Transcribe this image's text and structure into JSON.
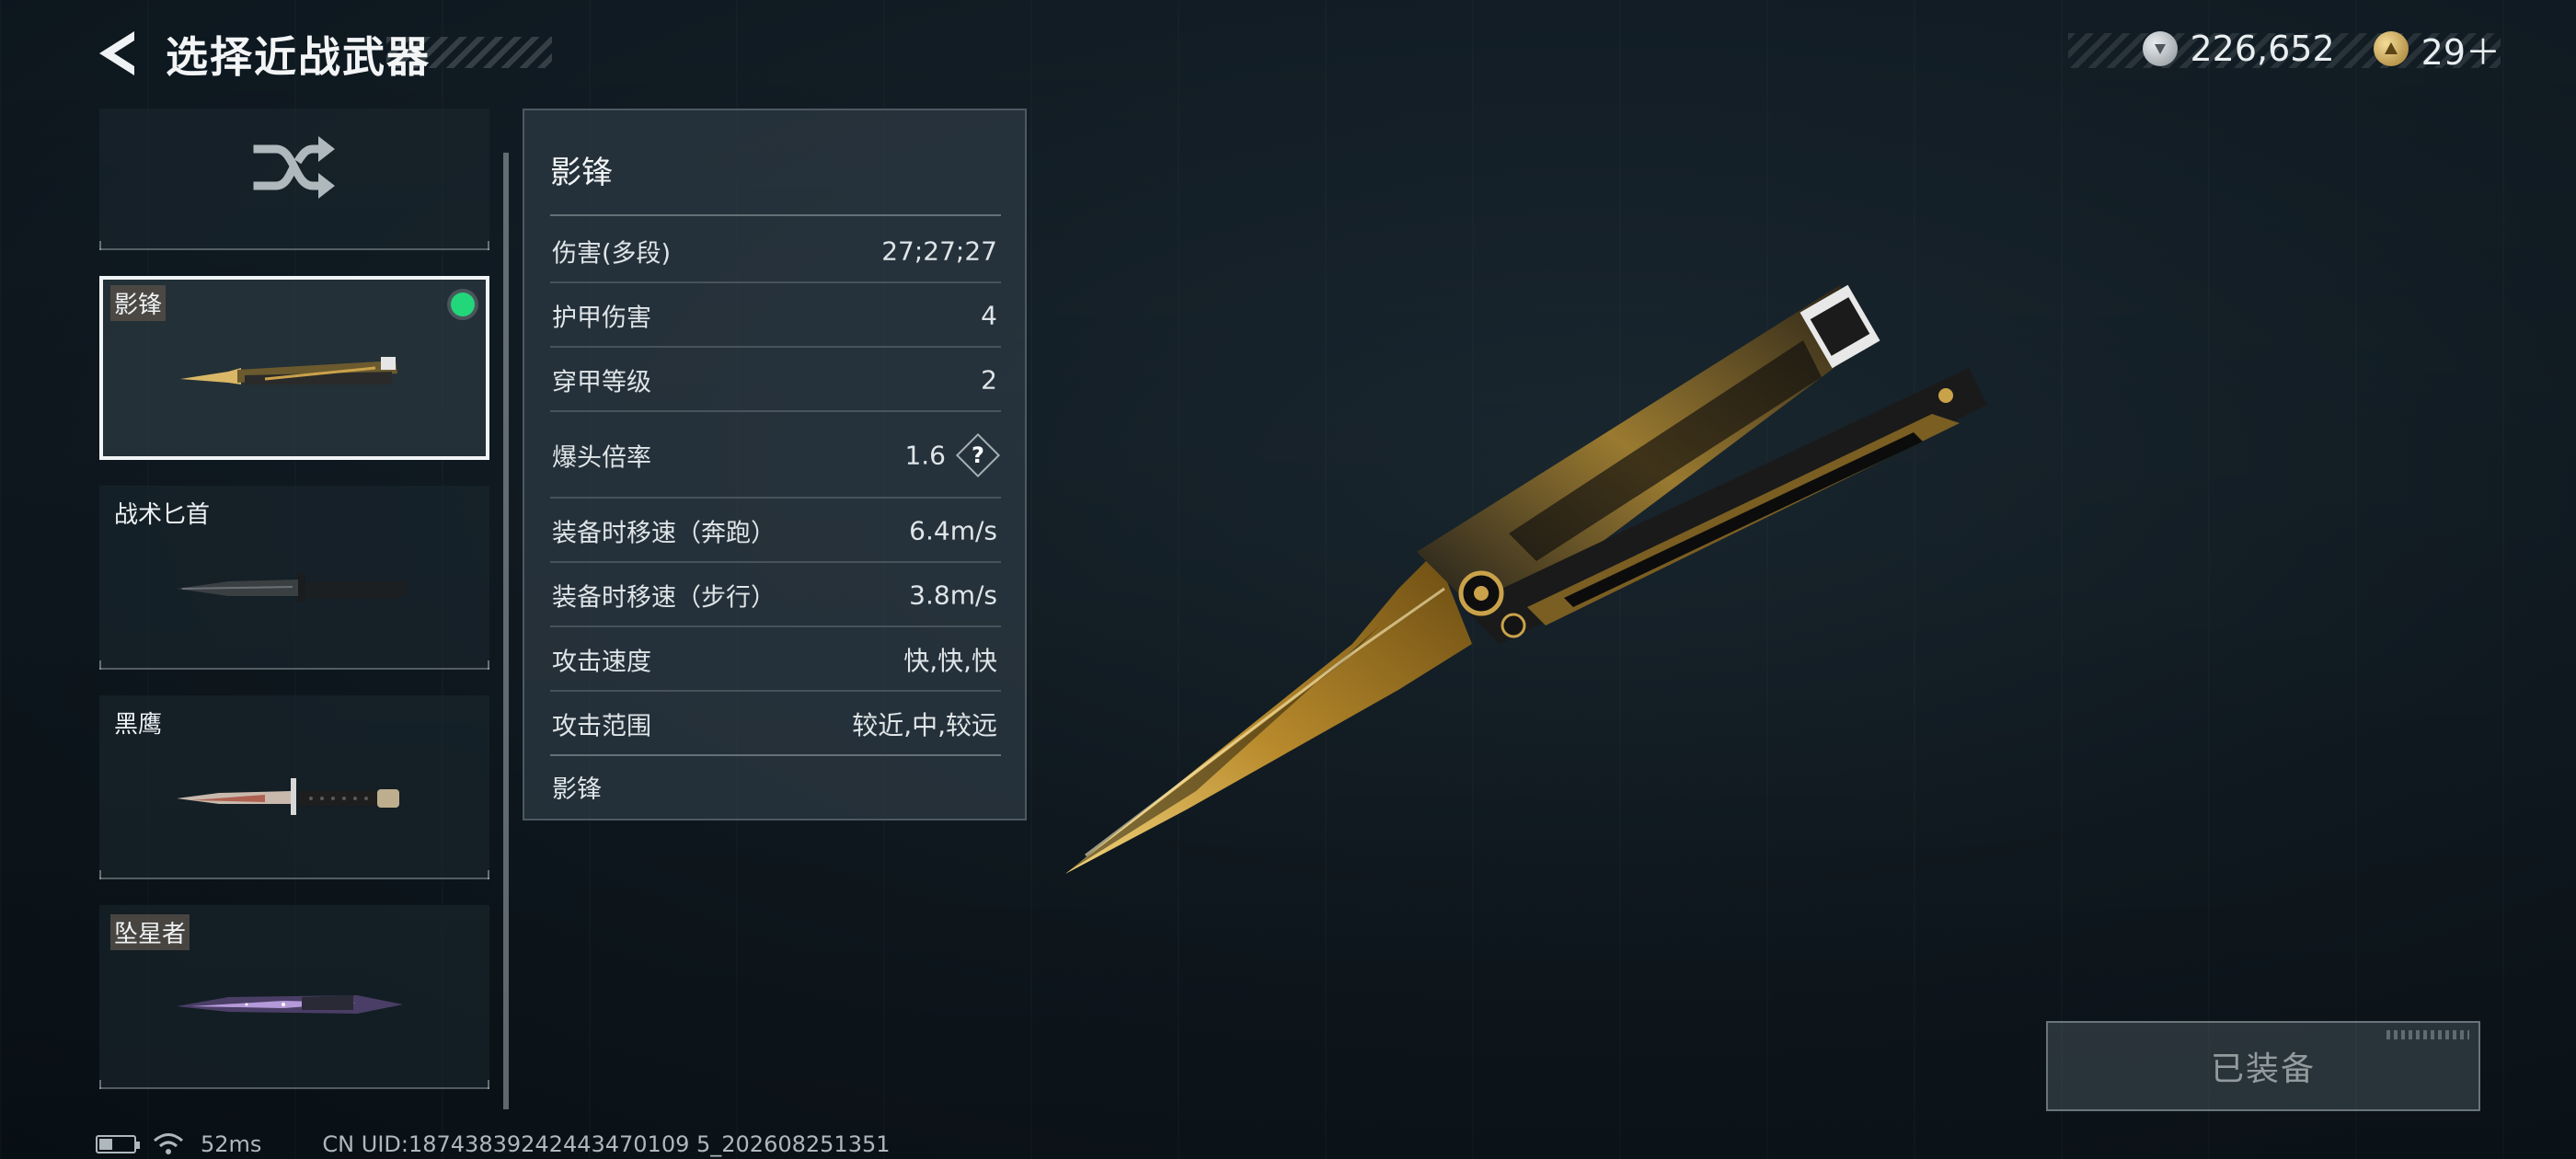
{
  "header": {
    "title": "选择近战武器",
    "currency": [
      {
        "icon": "silver-coin-icon",
        "value": "226,652"
      },
      {
        "icon": "gold-coin-icon",
        "value": "29＋"
      }
    ]
  },
  "weapon_list": {
    "random_icon": "shuffle-icon",
    "items": [
      {
        "label": "影锋",
        "selected": true,
        "equipped": true
      },
      {
        "label": "战术匕首",
        "selected": false,
        "equipped": false
      },
      {
        "label": "黑鹰",
        "selected": false,
        "equipped": false
      },
      {
        "label": "坠星者",
        "selected": false,
        "equipped": false
      }
    ]
  },
  "stats_panel": {
    "title": "影锋",
    "rows": [
      {
        "key": "伤害(多段)",
        "value": "27;27;27"
      },
      {
        "key": "护甲伤害",
        "value": "4"
      },
      {
        "key": "穿甲等级",
        "value": "2"
      },
      {
        "key": "爆头倍率",
        "value": "1.6",
        "help": "?"
      },
      {
        "key": "装备时移速（奔跑）",
        "value": "6.4m/s"
      },
      {
        "key": "装备时移速（步行）",
        "value": "3.8m/s"
      },
      {
        "key": "攻击速度",
        "value": "快,快,快"
      },
      {
        "key": "攻击范围",
        "value": "较近,中,较远"
      }
    ],
    "footer": "影锋"
  },
  "equip_button": {
    "label": "已装备"
  },
  "status_bar": {
    "ping": "52ms",
    "uid": "CN UID:18743839242443470109 5_202608251351"
  },
  "colors": {
    "equipped_dot": "#22d67a",
    "background": "#121d25",
    "gold_blade": "#c9a24a"
  }
}
